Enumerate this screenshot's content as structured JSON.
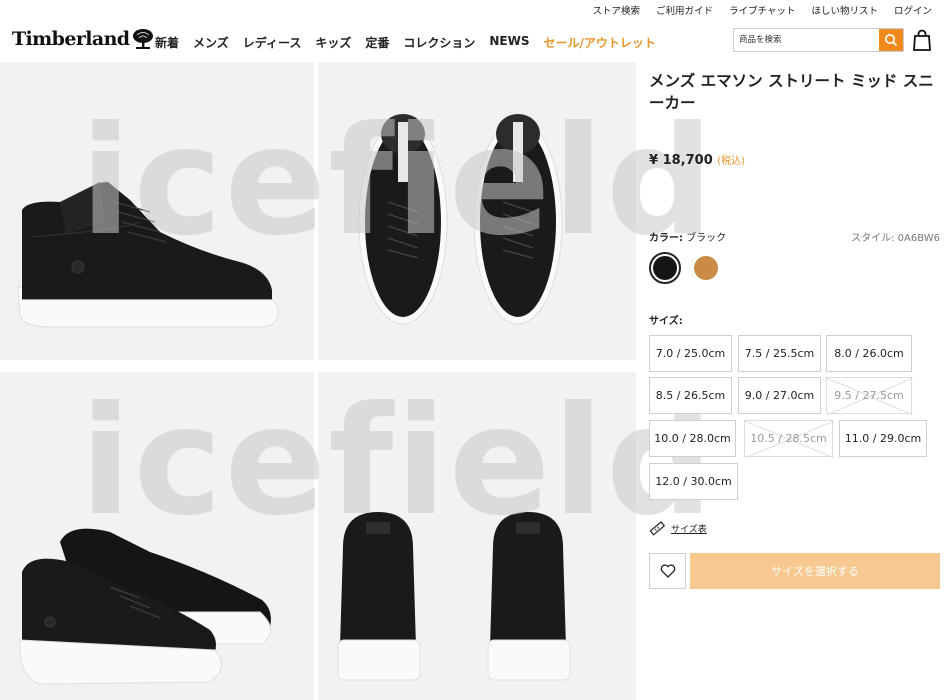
{
  "utility": [
    "ストア検索",
    "ご利用ガイド",
    "ライブチャット",
    "ほしい物リスト",
    "ログイン"
  ],
  "brand": {
    "logo_text": "Timberland"
  },
  "nav": {
    "items": [
      "新着",
      "メンズ",
      "レディース",
      "キッズ",
      "定番",
      "コレクション",
      "NEWS"
    ],
    "sale": "セール/アウトレット"
  },
  "search": {
    "placeholder": "商品を検索"
  },
  "gallery": {
    "watermark": "icefield"
  },
  "product": {
    "title": "メンズ エマソン ストリート ミッド スニーカー",
    "price": "¥ 18,700",
    "tax": "(税込)",
    "color_label": "カラー:",
    "color_value": "ブラック",
    "style_code": "スタイル: 0A6BW6",
    "size_label": "サイズ:",
    "sizes": [
      {
        "label": "7.0 / 25.0cm",
        "available": true
      },
      {
        "label": "7.5 / 25.5cm",
        "available": true
      },
      {
        "label": "8.0 / 26.0cm",
        "available": true
      },
      {
        "label": "8.5 / 26.5cm",
        "available": true
      },
      {
        "label": "9.0 / 27.0cm",
        "available": true
      },
      {
        "label": "9.5 / 27.5cm",
        "available": false
      },
      {
        "label": "10.0 / 28.0cm",
        "available": true
      },
      {
        "label": "10.5 / 28.5cm",
        "available": false
      },
      {
        "label": "11.0 / 29.0cm",
        "available": true
      },
      {
        "label": "12.0 / 30.0cm",
        "available": true
      }
    ],
    "size_chart": "サイズ表",
    "cta": "サイズを選択する"
  },
  "colors": {
    "accent": "#f08a1c",
    "sale": "#e8952a",
    "cta": "#f7c890",
    "swatch_black": "#151515",
    "swatch_wheat": "#c98b45"
  }
}
